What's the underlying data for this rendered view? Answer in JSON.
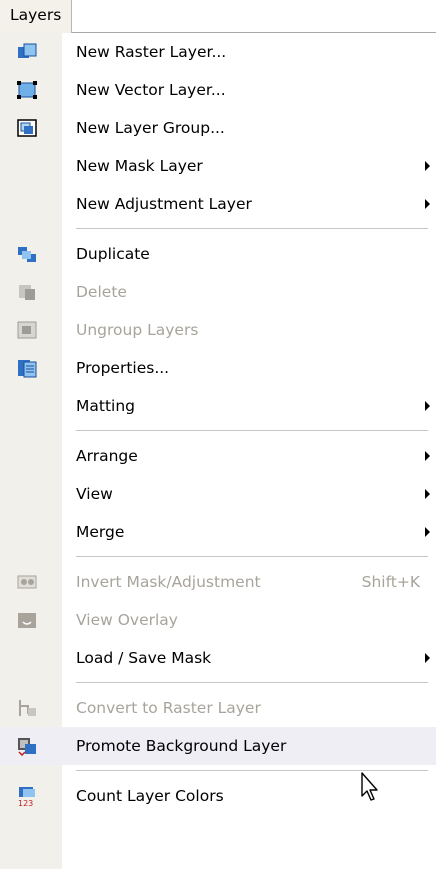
{
  "menubar": {
    "title": "Layers"
  },
  "menu": [
    {
      "type": "item",
      "name": "new-raster-layer",
      "label": "New Raster Layer...",
      "icon": "new-raster-layer-icon"
    },
    {
      "type": "item",
      "name": "new-vector-layer",
      "label": "New Vector Layer...",
      "icon": "new-vector-layer-icon"
    },
    {
      "type": "item",
      "name": "new-layer-group",
      "label": "New Layer Group...",
      "icon": "new-layer-group-icon"
    },
    {
      "type": "item",
      "name": "new-mask-layer",
      "label": "New Mask Layer",
      "submenu": true
    },
    {
      "type": "item",
      "name": "new-adjustment-layer",
      "label": "New Adjustment Layer",
      "submenu": true
    },
    {
      "type": "sep"
    },
    {
      "type": "item",
      "name": "duplicate",
      "label": "Duplicate",
      "icon": "duplicate-icon"
    },
    {
      "type": "item",
      "name": "delete",
      "label": "Delete",
      "icon": "delete-icon",
      "disabled": true
    },
    {
      "type": "item",
      "name": "ungroup-layers",
      "label": "Ungroup Layers",
      "icon": "ungroup-layers-icon",
      "disabled": true
    },
    {
      "type": "item",
      "name": "properties",
      "label": "Properties...",
      "icon": "properties-icon"
    },
    {
      "type": "item",
      "name": "matting",
      "label": "Matting",
      "submenu": true
    },
    {
      "type": "sep"
    },
    {
      "type": "item",
      "name": "arrange",
      "label": "Arrange",
      "submenu": true
    },
    {
      "type": "item",
      "name": "view",
      "label": "View",
      "submenu": true
    },
    {
      "type": "item",
      "name": "merge",
      "label": "Merge",
      "submenu": true
    },
    {
      "type": "sep"
    },
    {
      "type": "item",
      "name": "invert-mask-adjustment",
      "label": "Invert Mask/Adjustment",
      "icon": "invert-mask-icon",
      "disabled": true,
      "shortcut": "Shift+K"
    },
    {
      "type": "item",
      "name": "view-overlay",
      "label": "View Overlay",
      "icon": "view-overlay-icon",
      "disabled": true
    },
    {
      "type": "item",
      "name": "load-save-mask",
      "label": "Load / Save Mask",
      "submenu": true
    },
    {
      "type": "sep"
    },
    {
      "type": "item",
      "name": "convert-to-raster-layer",
      "label": "Convert to Raster Layer",
      "icon": "convert-raster-icon",
      "disabled": true
    },
    {
      "type": "item",
      "name": "promote-background-layer",
      "label": "Promote Background Layer",
      "icon": "promote-background-icon",
      "highlighted": true
    },
    {
      "type": "sep"
    },
    {
      "type": "item",
      "name": "count-layer-colors",
      "label": "Count Layer Colors",
      "icon": "count-colors-icon"
    }
  ]
}
